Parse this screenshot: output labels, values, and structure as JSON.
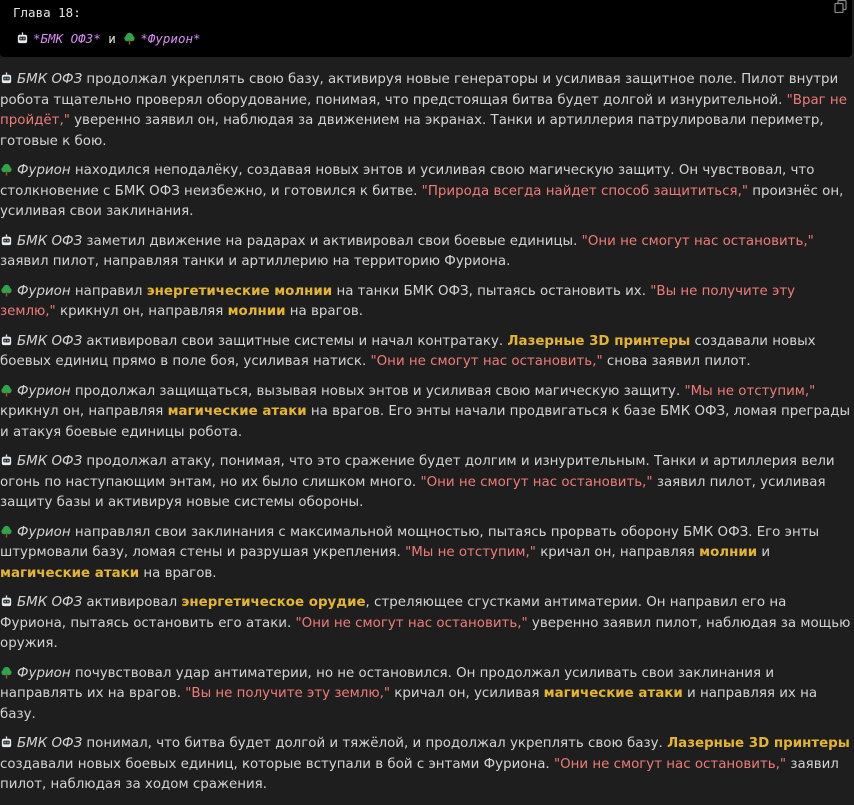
{
  "header": {
    "chapter": "Глава 18:",
    "side_a": "*БМК ОФЗ*",
    "joiner": "и",
    "side_b": "*Фурион*",
    "icon_a": "robot-icon",
    "icon_b": "tree-icon",
    "copy_icon": "copy-icon"
  },
  "colors": {
    "quote": "#f07c78",
    "highlight": "#e5b530",
    "italic_purple": "#d78cf2",
    "text": "#d4d4d4",
    "background": "#1e1e1e"
  },
  "paragraphs": [
    {
      "icon": "robot",
      "segments": [
        {
          "t": "БМК ОФЗ",
          "s": "em"
        },
        {
          "t": " продолжал укреплять свою базу, активируя новые генераторы и усиливая защитное поле. Пилот внутри робота тщательно проверял оборудование, понимая, что предстоящая битва будет долгой и изнурительной. ",
          "s": ""
        },
        {
          "t": "\"Враг не пройдёт,\"",
          "s": "quote"
        },
        {
          "t": " уверенно заявил он, наблюдая за движением на экранах. Танки и артиллерия патрулировали периметр, готовые к бою.",
          "s": ""
        }
      ]
    },
    {
      "icon": "tree",
      "segments": [
        {
          "t": "Фурион",
          "s": "em"
        },
        {
          "t": " находился неподалёку, создавая новых энтов и усиливая свою магическую защиту. Он чувствовал, что столкновение с БМК ОФЗ неизбежно, и готовился к битве. ",
          "s": ""
        },
        {
          "t": "\"Природа всегда найдет способ защититься,\"",
          "s": "quote"
        },
        {
          "t": " произнёс он, усиливая свои заклинания.",
          "s": ""
        }
      ]
    },
    {
      "icon": "robot",
      "segments": [
        {
          "t": "БМК ОФЗ",
          "s": "em"
        },
        {
          "t": " заметил движение на радарах и активировал свои боевые единицы. ",
          "s": ""
        },
        {
          "t": "\"Они не смогут нас остановить,\"",
          "s": "quote"
        },
        {
          "t": " заявил пилот, направляя танки и артиллерию на территорию Фуриона.",
          "s": ""
        }
      ]
    },
    {
      "icon": "tree",
      "segments": [
        {
          "t": "Фурион",
          "s": "em"
        },
        {
          "t": " направил ",
          "s": ""
        },
        {
          "t": "энергетические молнии",
          "s": "hl"
        },
        {
          "t": " на танки БМК ОФЗ, пытаясь остановить их. ",
          "s": ""
        },
        {
          "t": "\"Вы не получите эту землю,\"",
          "s": "quote"
        },
        {
          "t": " крикнул он, направляя ",
          "s": ""
        },
        {
          "t": "молнии",
          "s": "hl"
        },
        {
          "t": " на врагов.",
          "s": ""
        }
      ]
    },
    {
      "icon": "robot",
      "segments": [
        {
          "t": "БМК ОФЗ",
          "s": "em"
        },
        {
          "t": " активировал свои защитные системы и начал контратаку. ",
          "s": ""
        },
        {
          "t": "Лазерные 3D принтеры",
          "s": "hl"
        },
        {
          "t": " создавали новых боевых единиц прямо в поле боя, усиливая натиск. ",
          "s": ""
        },
        {
          "t": "\"Они не смогут нас остановить,\"",
          "s": "quote"
        },
        {
          "t": " снова заявил пилот.",
          "s": ""
        }
      ]
    },
    {
      "icon": "tree",
      "segments": [
        {
          "t": "Фурион",
          "s": "em"
        },
        {
          "t": " продолжал защищаться, вызывая новых энтов и усиливая свою магическую защиту. ",
          "s": ""
        },
        {
          "t": "\"Мы не отступим,\"",
          "s": "quote"
        },
        {
          "t": " крикнул он, направляя ",
          "s": ""
        },
        {
          "t": "магические атаки",
          "s": "hl"
        },
        {
          "t": " на врагов. Его энты начали продвигаться к базе БМК ОФЗ, ломая преграды и атакуя боевые единицы робота.",
          "s": ""
        }
      ]
    },
    {
      "icon": "robot",
      "segments": [
        {
          "t": "БМК ОФЗ",
          "s": "em"
        },
        {
          "t": " продолжал атаку, понимая, что это сражение будет долгим и изнурительным. Танки и артиллерия вели огонь по наступающим энтам, но их было слишком много. ",
          "s": ""
        },
        {
          "t": "\"Они не смогут нас остановить,\"",
          "s": "quote"
        },
        {
          "t": " заявил пилот, усиливая защиту базы и активируя новые системы обороны.",
          "s": ""
        }
      ]
    },
    {
      "icon": "tree",
      "segments": [
        {
          "t": "Фурион",
          "s": "em"
        },
        {
          "t": " направлял свои заклинания с максимальной мощностью, пытаясь прорвать оборону БМК ОФЗ. Его энты штурмовали базу, ломая стены и разрушая укрепления. ",
          "s": ""
        },
        {
          "t": "\"Мы не отступим,\"",
          "s": "quote"
        },
        {
          "t": " кричал он, направляя ",
          "s": ""
        },
        {
          "t": "молнии",
          "s": "hl"
        },
        {
          "t": " и ",
          "s": ""
        },
        {
          "t": "магические атаки",
          "s": "hl"
        },
        {
          "t": " на врагов.",
          "s": ""
        }
      ]
    },
    {
      "icon": "robot",
      "segments": [
        {
          "t": "БМК ОФЗ",
          "s": "em"
        },
        {
          "t": " активировал ",
          "s": ""
        },
        {
          "t": "энергетическое орудие",
          "s": "hl"
        },
        {
          "t": ", стреляющее сгустками антиматерии. Он направил его на Фуриона, пытаясь остановить его атаки. ",
          "s": ""
        },
        {
          "t": "\"Они не смогут нас остановить,\"",
          "s": "quote"
        },
        {
          "t": " уверенно заявил пилот, наблюдая за мощью оружия.",
          "s": ""
        }
      ]
    },
    {
      "icon": "tree",
      "segments": [
        {
          "t": "Фурион",
          "s": "em"
        },
        {
          "t": " почувствовал удар антиматерии, но не остановился. Он продолжал усиливать свои заклинания и направлять их на врагов. ",
          "s": ""
        },
        {
          "t": "\"Вы не получите эту землю,\"",
          "s": "quote"
        },
        {
          "t": " кричал он, усиливая ",
          "s": ""
        },
        {
          "t": "магические атаки",
          "s": "hl"
        },
        {
          "t": " и направляя их на базу.",
          "s": ""
        }
      ]
    },
    {
      "icon": "robot",
      "segments": [
        {
          "t": "БМК ОФЗ",
          "s": "em"
        },
        {
          "t": " понимал, что битва будет долгой и тяжёлой, и продолжал укреплять свою базу. ",
          "s": ""
        },
        {
          "t": "Лазерные 3D принтеры",
          "s": "hl"
        },
        {
          "t": " создавали новых боевых единиц, которые вступали в бой с энтами Фуриона. ",
          "s": ""
        },
        {
          "t": "\"Они не смогут нас остановить,\"",
          "s": "quote"
        },
        {
          "t": " заявил пилот, наблюдая за ходом сражения.",
          "s": ""
        }
      ]
    }
  ]
}
